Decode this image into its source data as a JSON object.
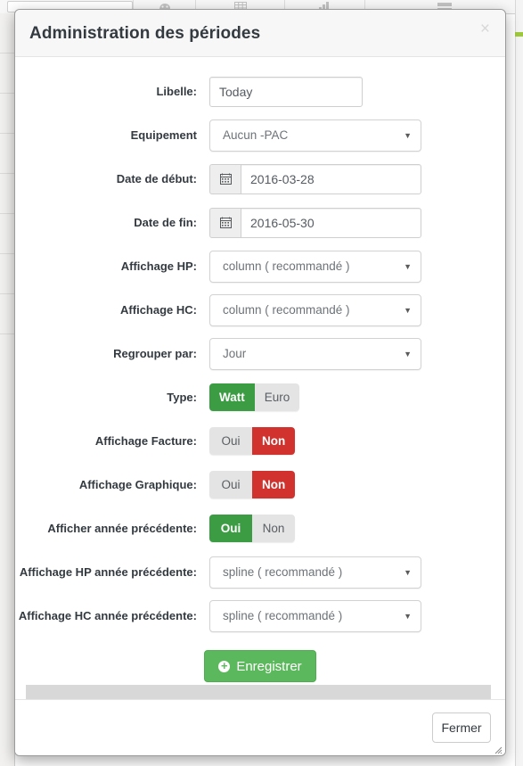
{
  "background": {
    "toolbar_icons": [
      "search-box",
      "palette-icon",
      "grid-icon",
      "bar-chart-icon",
      "server-list-icon"
    ],
    "accent_color": "#9fc93c"
  },
  "modal": {
    "title": "Administration des périodes",
    "close_icon": "×",
    "footer": {
      "close_label": "Fermer"
    },
    "save": {
      "label": "Enregistrer",
      "icon": "plus-circle-icon",
      "color": "#5cb85c"
    },
    "fields": [
      {
        "id": "libelle",
        "label": "Libelle:",
        "type": "text",
        "value": "Today",
        "placeholder": ""
      },
      {
        "id": "equipement",
        "label": "Equipement",
        "type": "select",
        "value": "Aucun -PAC"
      },
      {
        "id": "date-debut",
        "label": "Date de début:",
        "type": "date",
        "value": "2016-03-28",
        "icon": "calendar-icon"
      },
      {
        "id": "date-fin",
        "label": "Date de fin:",
        "type": "date",
        "value": "2016-05-30",
        "icon": "calendar-icon"
      },
      {
        "id": "affichage-hp",
        "label": "Affichage HP:",
        "type": "select",
        "value": "column ( recommandé )"
      },
      {
        "id": "affichage-hc",
        "label": "Affichage HC:",
        "type": "select",
        "value": "column ( recommandé )"
      },
      {
        "id": "regrouper-par",
        "label": "Regrouper par:",
        "type": "select",
        "value": "Jour"
      },
      {
        "id": "type",
        "label": "Type:",
        "type": "toggle",
        "options": [
          "Watt",
          "Euro"
        ],
        "selected": "Watt",
        "selected_color": "#3c9c44"
      },
      {
        "id": "affichage-facture",
        "label": "Affichage Facture:",
        "type": "toggle",
        "options": [
          "Oui",
          "Non"
        ],
        "selected": "Non",
        "selected_color": "#d2322d"
      },
      {
        "id": "affichage-graphique",
        "label": "Affichage Graphique:",
        "type": "toggle",
        "options": [
          "Oui",
          "Non"
        ],
        "selected": "Non",
        "selected_color": "#d2322d"
      },
      {
        "id": "afficher-annee-precedente",
        "label": "Afficher année précédente:",
        "type": "toggle",
        "options": [
          "Oui",
          "Non"
        ],
        "selected": "Oui",
        "selected_color": "#3c9c44"
      },
      {
        "id": "affichage-hp-annee-precedente",
        "label": "Affichage HP année précédente:",
        "type": "select",
        "value": "spline ( recommandé )"
      },
      {
        "id": "affichage-hc-annee-precedente",
        "label": "Affichage HC année précédente:",
        "type": "select",
        "value": "spline ( recommandé )"
      }
    ]
  }
}
